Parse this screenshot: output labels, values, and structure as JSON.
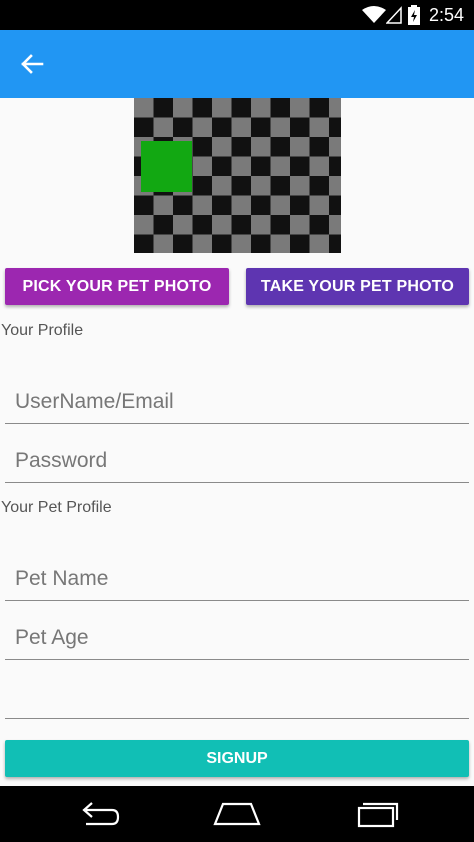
{
  "status_bar": {
    "time": "2:54",
    "icons": [
      "wifi-icon",
      "signal-icon",
      "battery-icon"
    ]
  },
  "app_bar": {
    "back_icon": "arrow-left-icon",
    "color": "#2196f3"
  },
  "photo": {
    "description_icon": "pet-photo-placeholder"
  },
  "buttons": {
    "pick_photo": "PICK YOUR PET PHOTO",
    "take_photo": "TAKE YOUR PET PHOTO",
    "signup": "SIGNUP"
  },
  "profile": {
    "label": "Your Profile",
    "username_placeholder": "UserName/Email",
    "password_placeholder": "Password"
  },
  "pet_profile": {
    "label": "Your Pet Profile",
    "pet_name_placeholder": "Pet Name",
    "pet_age_placeholder": "Pet Age",
    "extra_placeholder": ""
  },
  "colors": {
    "pick_button": "#9c27b0",
    "take_button": "#5e35b1",
    "signup_button": "#11bfb5"
  },
  "nav_bar": {
    "icons": [
      "back-nav-icon",
      "home-nav-icon",
      "recents-nav-icon"
    ]
  }
}
